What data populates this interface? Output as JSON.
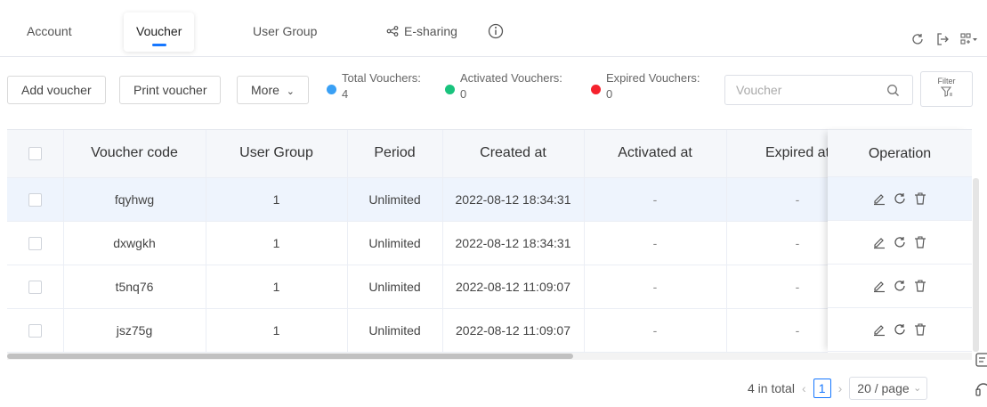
{
  "tabs": [
    {
      "label": "Account"
    },
    {
      "label": "Voucher"
    },
    {
      "label": "User Group"
    },
    {
      "label": "E-sharing",
      "icon": "share-icon"
    }
  ],
  "active_tab": "Voucher",
  "toolbar": {
    "add_voucher": "Add voucher",
    "print_voucher": "Print voucher",
    "more": "More",
    "search_placeholder": "Voucher",
    "filter_label": "Filter"
  },
  "stats": {
    "total_label": "Total Vouchers:",
    "total_value": "4",
    "total_color": "#3aa0f5",
    "activated_label": "Activated Vouchers:",
    "activated_value": "0",
    "activated_color": "#19c37d",
    "expired_label": "Expired Vouchers:",
    "expired_value": "0",
    "expired_color": "#f5222d"
  },
  "table": {
    "headers": {
      "voucher_code": "Voucher code",
      "user_group": "User Group",
      "period": "Period",
      "created_at": "Created at",
      "activated_at": "Activated at",
      "expired_at": "Expired at",
      "operation": "Operation"
    },
    "rows": [
      {
        "code": "fqyhwg",
        "group": "1",
        "period": "Unlimited",
        "created": "2022-08-12 18:34:31",
        "activated": "-",
        "expired": "-"
      },
      {
        "code": "dxwgkh",
        "group": "1",
        "period": "Unlimited",
        "created": "2022-08-12 18:34:31",
        "activated": "-",
        "expired": "-"
      },
      {
        "code": "t5nq76",
        "group": "1",
        "period": "Unlimited",
        "created": "2022-08-12 11:09:07",
        "activated": "-",
        "expired": "-"
      },
      {
        "code": "jsz75g",
        "group": "1",
        "period": "Unlimited",
        "created": "2022-08-12 11:09:07",
        "activated": "-",
        "expired": "-"
      }
    ]
  },
  "pagination": {
    "total_text": "4 in total",
    "current_page": "1",
    "page_size": "20 / page"
  },
  "colors": {
    "accent": "#1677ff",
    "highlight_row": "#eef4fd"
  }
}
